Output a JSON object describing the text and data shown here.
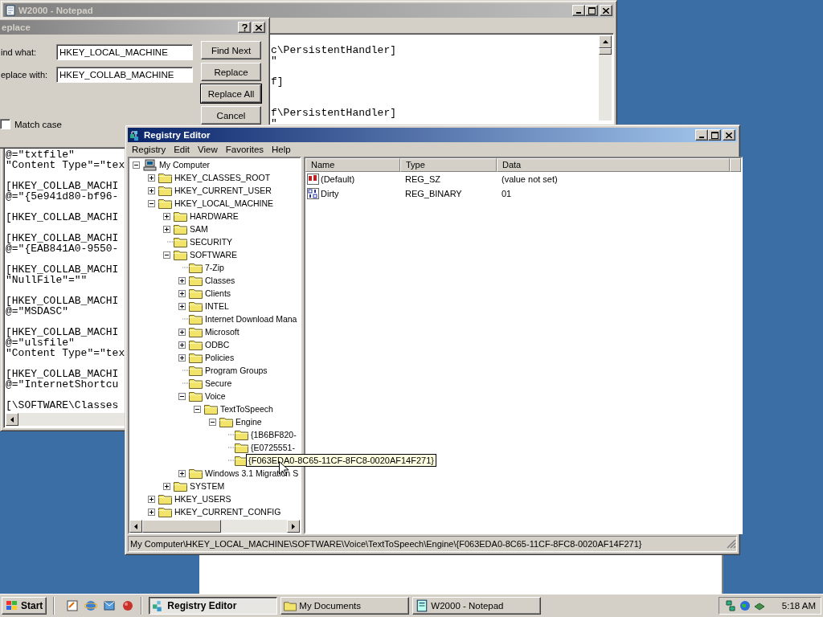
{
  "notepad": {
    "title": "W2000 - Notepad",
    "text_right": [
      [
        "c\\PersistentHandler]",
        "\""
      ],
      [
        "f]"
      ],
      [
        "f\\PersistentHandler]",
        "\""
      ]
    ],
    "text_left": [
      [
        "@=\"txtfile\"",
        "\"Content Type\"=\"tex"
      ],
      [
        "[HKEY_COLLAB_MACHI",
        "@=\"{5e941d80-bf96-"
      ],
      [
        "[HKEY_COLLAB_MACHI"
      ],
      [
        "[HKEY_COLLAB_MACHI",
        "@=\"{EAB841A0-9550-"
      ],
      [
        "[HKEY_COLLAB_MACHI",
        "\"NullFile\"=\"\""
      ],
      [
        "[HKEY_COLLAB_MACHI",
        "@=\"MSDASC\""
      ],
      [
        "[HKEY_COLLAB_MACHI",
        "@=\"ulsfile\"",
        "\"Content Type\"=\"tex"
      ],
      [
        "[HKEY_COLLAB_MACHI",
        "@=\"InternetShortcu"
      ],
      [
        "[\\SOFTWARE\\Classes"
      ]
    ]
  },
  "replace_dialog": {
    "title": "eplace",
    "find_label": "ind what:",
    "find_value": "HKEY_LOCAL_MACHINE",
    "replace_label": "eplace with:",
    "replace_value": "HKEY_COLLAB_MACHINE",
    "buttons": [
      {
        "label": "Find Next",
        "default": false
      },
      {
        "label": "Replace",
        "default": false
      },
      {
        "label": "Replace All",
        "default": true
      },
      {
        "label": "Cancel",
        "default": false
      }
    ],
    "match_case": {
      "label": "Match case",
      "checked": false
    }
  },
  "registry_editor": {
    "title": "Registry Editor",
    "menu": [
      "Registry",
      "Edit",
      "View",
      "Favorites",
      "Help"
    ],
    "tree": [
      {
        "label": "My Computer",
        "kind": "expanded",
        "children": [
          {
            "label": "HKEY_CLASSES_ROOT",
            "kind": "collapsed"
          },
          {
            "label": "HKEY_CURRENT_USER",
            "kind": "collapsed"
          },
          {
            "label": "HKEY_LOCAL_MACHINE",
            "kind": "expanded",
            "children": [
              {
                "label": "HARDWARE",
                "kind": "collapsed"
              },
              {
                "label": "SAM",
                "kind": "collapsed"
              },
              {
                "label": "SECURITY",
                "kind": "leaf"
              },
              {
                "label": "SOFTWARE",
                "kind": "expanded",
                "children": [
                  {
                    "label": "7-Zip",
                    "kind": "leaf"
                  },
                  {
                    "label": "Classes",
                    "kind": "collapsed"
                  },
                  {
                    "label": "Clients",
                    "kind": "collapsed"
                  },
                  {
                    "label": "INTEL",
                    "kind": "collapsed"
                  },
                  {
                    "label": "Internet Download Mana",
                    "kind": "leaf"
                  },
                  {
                    "label": "Microsoft",
                    "kind": "collapsed"
                  },
                  {
                    "label": "ODBC",
                    "kind": "collapsed"
                  },
                  {
                    "label": "Policies",
                    "kind": "collapsed"
                  },
                  {
                    "label": "Program Groups",
                    "kind": "leaf"
                  },
                  {
                    "label": "Secure",
                    "kind": "leaf"
                  },
                  {
                    "label": "Voice",
                    "kind": "expanded",
                    "children": [
                      {
                        "label": "TextToSpeech",
                        "kind": "expanded",
                        "children": [
                          {
                            "label": "Engine",
                            "kind": "expanded",
                            "children": [
                              {
                                "label": "{1B6BF820-",
                                "kind": "leaf"
                              },
                              {
                                "label": "{E0725551-",
                                "kind": "leaf"
                              },
                              {
                                "kind": "leaf",
                                "tooltip": "{F063EDA0-8C65-11CF-8FC8-0020AF14F271}"
                              }
                            ]
                          }
                        ]
                      }
                    ]
                  },
                  {
                    "label": "Windows 3.1 Migration S",
                    "kind": "collapsed"
                  }
                ]
              },
              {
                "label": "SYSTEM",
                "kind": "collapsed"
              }
            ]
          },
          {
            "label": "HKEY_USERS",
            "kind": "collapsed"
          },
          {
            "label": "HKEY_CURRENT_CONFIG",
            "kind": "collapsed"
          }
        ]
      }
    ],
    "columns": [
      "Name",
      "Type",
      "Data"
    ],
    "values": [
      {
        "kind": "string",
        "name": "(Default)",
        "type": "REG_SZ",
        "data": "(value not set)"
      },
      {
        "kind": "binary",
        "name": "Dirty",
        "type": "REG_BINARY",
        "data": "01"
      }
    ],
    "status_bar": "My Computer\\HKEY_LOCAL_MACHINE\\SOFTWARE\\Voice\\TextToSpeech\\Engine\\{F063EDA0-8C65-11CF-8FC8-0020AF14F271}"
  },
  "taskbar": {
    "start": "Start",
    "tasks": [
      {
        "label": "Registry Editor",
        "selected": true
      },
      {
        "label": "My Documents",
        "selected": false
      },
      {
        "label": "W2000 - Notepad",
        "selected": false
      }
    ],
    "clock": "5:18 AM"
  }
}
